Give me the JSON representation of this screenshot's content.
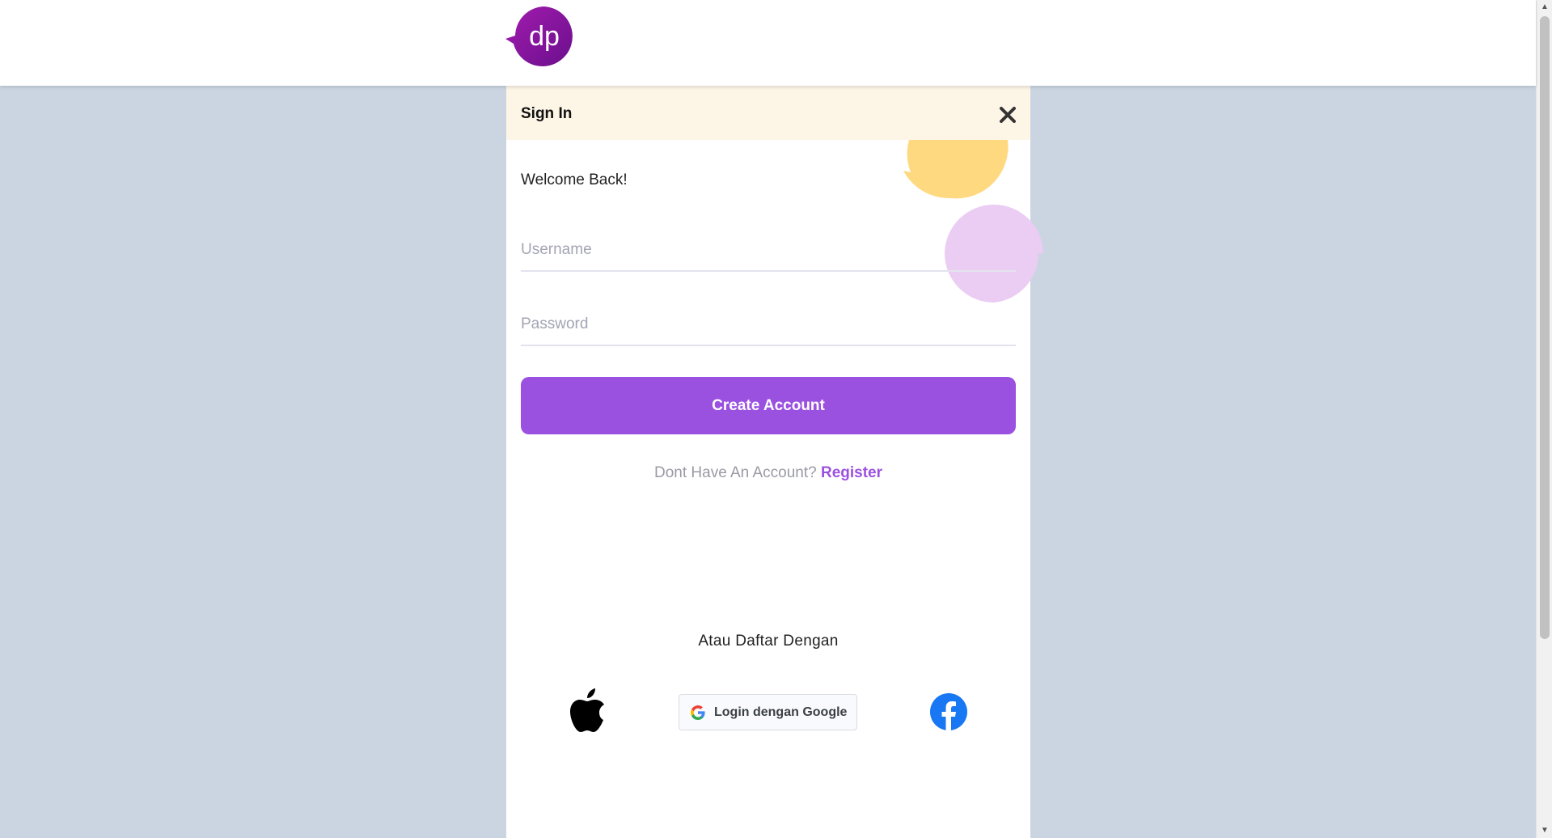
{
  "header": {
    "logo_text": "dp"
  },
  "modal": {
    "title": "Sign In",
    "welcome": "Welcome Back!",
    "username_placeholder": "Username",
    "password_placeholder": "Password",
    "submit_label": "Create Account",
    "register_prompt": "Dont Have An Account?",
    "register_link": "Register",
    "alt_text": "Atau Daftar Dengan",
    "google_label": "Login dengan Google"
  },
  "icons": {
    "close": "close-icon",
    "apple": "apple-icon",
    "google": "google-icon",
    "facebook": "facebook-icon"
  },
  "colors": {
    "accent": "#9b51e0",
    "header_bg": "#fdf5e6",
    "backdrop": "#cbd5e1",
    "logo": "#8b1aa8",
    "decor_yellow": "#ffd980",
    "decor_pink": "#ebccf3",
    "facebook_blue": "#1877f2"
  }
}
